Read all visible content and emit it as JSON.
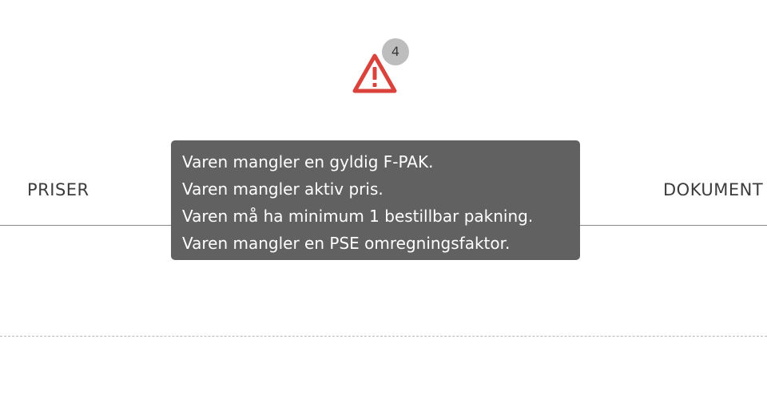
{
  "warning": {
    "icon": "warning-triangle-icon",
    "count": "4",
    "color": "#d9433b"
  },
  "tabs": [
    {
      "label": "PRISER"
    },
    {
      "label": "DOKUMENT"
    }
  ],
  "tooltip": {
    "lines": [
      "Varen mangler en gyldig F-PAK.",
      "Varen mangler aktiv pris.",
      "Varen må ha minimum 1 bestillbar pakning.",
      "Varen mangler en PSE omregningsfaktor."
    ]
  }
}
